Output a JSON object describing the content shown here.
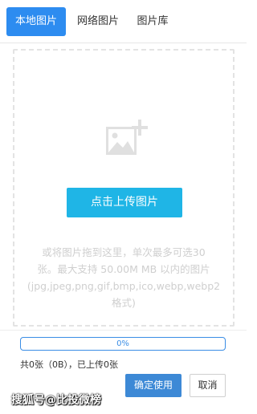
{
  "tabs": {
    "local": "本地图片",
    "network": "网络图片",
    "library": "图片库"
  },
  "upload": {
    "button_label": "点击上传图片",
    "hint_lines": [
      "或将图片拖到这里，单次最多可选30",
      "张。最大支持 50.00M MB 以内的图片",
      "(jpg,jpeg,png,gif,bmp,ico,webp,webp2",
      "格式)"
    ]
  },
  "progress": {
    "percent": 0,
    "label": "0%"
  },
  "status_text": "共0张（0B），已上传0张",
  "actions": {
    "confirm": "确定使用",
    "cancel": "取消"
  },
  "watermark": "搜狐号@比投微榜",
  "colors": {
    "tab_active": "#2d8cf0",
    "upload_button": "#1fb5e6",
    "confirm_button": "#3d89d6",
    "progress_border": "#3a8de5"
  },
  "icons": {
    "placeholder": "image-add-icon"
  }
}
